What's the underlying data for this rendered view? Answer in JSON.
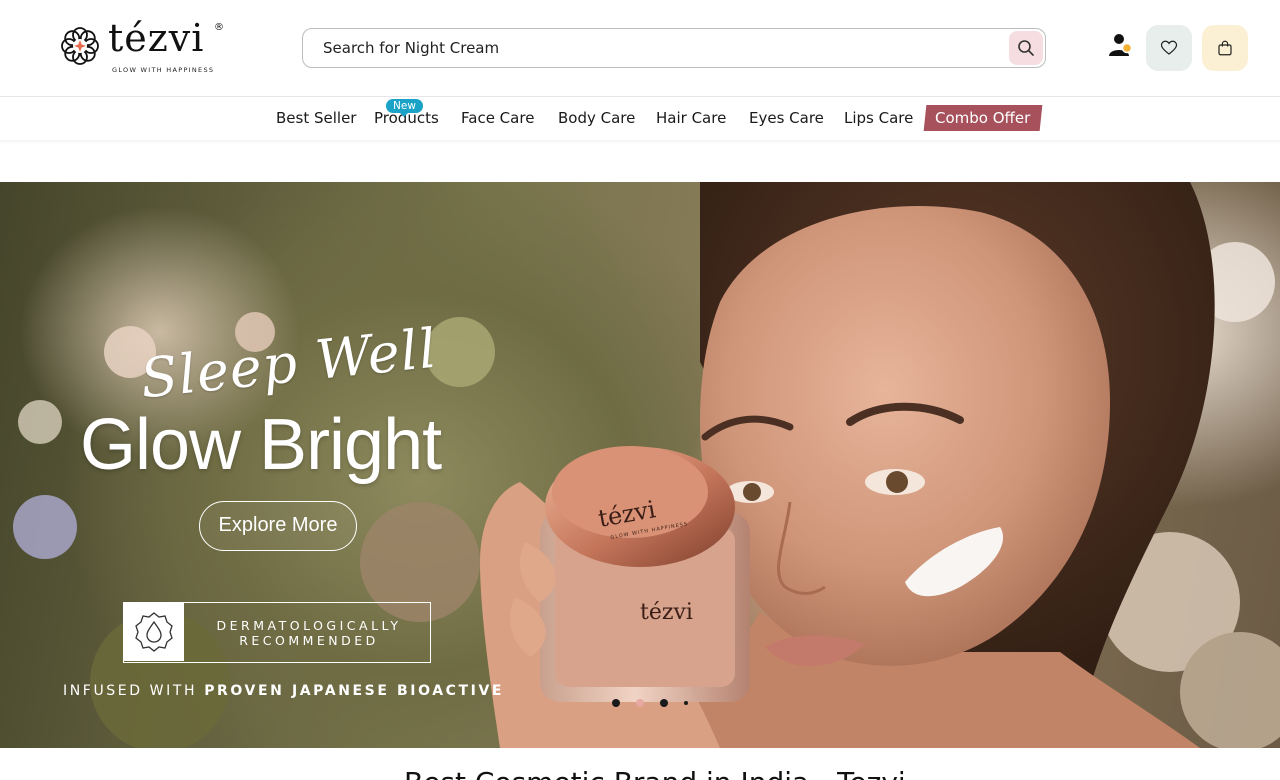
{
  "brand": {
    "name": "tézvi",
    "registered": "®",
    "tagline": "GLOW WITH HAPPINESS"
  },
  "search": {
    "placeholder": "Search for Night Cream"
  },
  "header_icons": [
    "user-icon",
    "heart-icon",
    "bag-icon"
  ],
  "nav": {
    "items": [
      {
        "label": "Best Seller"
      },
      {
        "label": "Products",
        "badge": "New"
      },
      {
        "label": "Face Care"
      },
      {
        "label": "Body Care"
      },
      {
        "label": "Hair Care"
      },
      {
        "label": "Eyes Care"
      },
      {
        "label": "Lips Care"
      },
      {
        "label": "Combo Offer"
      }
    ]
  },
  "hero": {
    "script_title": "Sleep Well",
    "title": "Glow Bright",
    "cta": "Explore More",
    "badge_line1": "DERMATOLOGICALLY",
    "badge_line2": "RECOMMENDED",
    "infused_prefix": "INFUSED WITH",
    "infused_bold": "PROVEN JAPANESE BIOACTIVE",
    "jar_brand": "tézvi",
    "jar_tagline": "GLOW WITH HAPPINESS",
    "slides": 4,
    "active_slide": 2
  },
  "section": {
    "title": "Best Cosmetic Brand in India - Tezvi"
  },
  "colors": {
    "search_button_bg": "#f6dde2",
    "wishlist_bg": "#e7eeec",
    "cart_bg": "#fbf0d4",
    "new_badge": "#1aa3c6",
    "combo_bg": "#a6515c",
    "active_dot": "#e7a9a1"
  }
}
